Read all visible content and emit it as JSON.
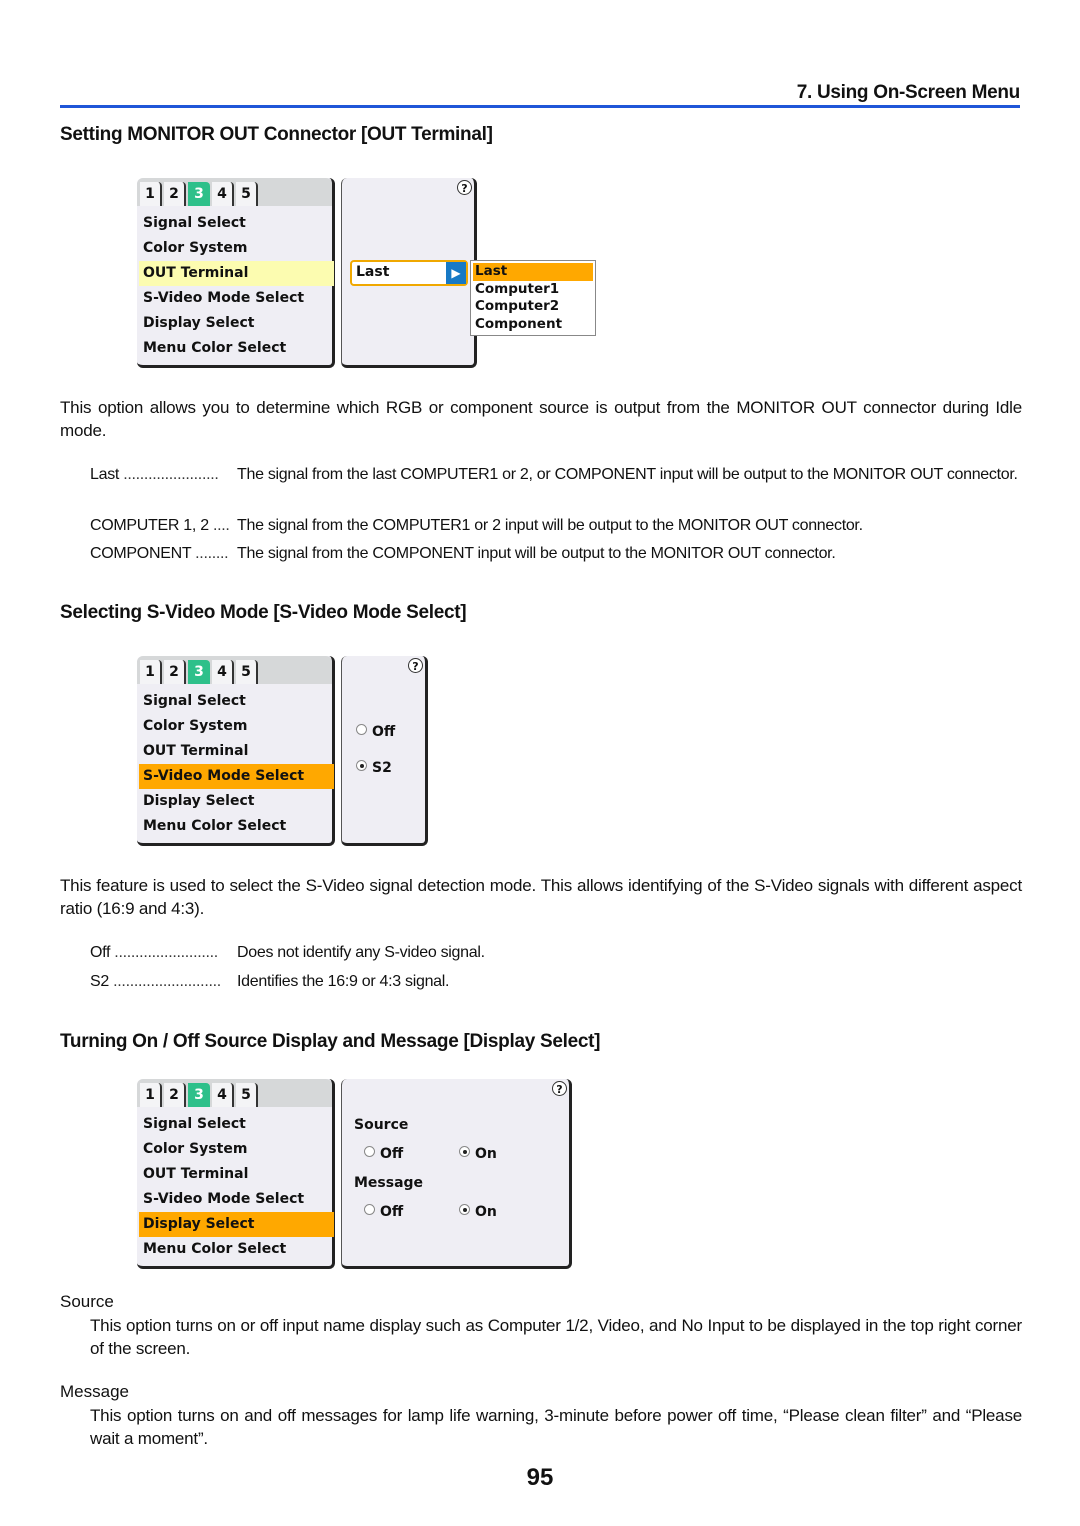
{
  "header": {
    "chapter_title": "7. Using On-Screen Menu",
    "accent_color": "#1f56d8"
  },
  "osd_common": {
    "tabs": [
      "1",
      "2",
      "3",
      "4",
      "5"
    ],
    "active_tab": "3",
    "menu_items": [
      "Signal Select",
      "Color System",
      "OUT Terminal",
      "S-Video Mode Select",
      "Display Select",
      "Menu Color Select"
    ],
    "help_icon": "?"
  },
  "sections": [
    {
      "heading": "Setting MONITOR OUT Connector [OUT Terminal]",
      "osd": {
        "highlighted_item": "OUT Terminal",
        "select_value": "Last",
        "dropdown_options": [
          "Last",
          "Computer1",
          "Computer2",
          "Component"
        ],
        "dropdown_selected": "Last"
      },
      "paragraph": "This option allows you to determine which RGB or component source is output from the MONITOR OUT connector during Idle mode.",
      "definitions": [
        {
          "term": "Last",
          "dots": " .......................",
          "desc": "The signal from the last COMPUTER1 or 2, or COMPONENT input will be output to the MONITOR OUT connector."
        },
        {
          "term": "COMPUTER 1, 2",
          "dots": " ....",
          "desc": "The signal from the COMPUTER1 or 2 input will be output to the MONITOR OUT connector."
        },
        {
          "term": "COMPONENT",
          "dots": " ........",
          "desc": "The signal from the COMPONENT input will be output to the MONITOR OUT connector."
        }
      ]
    },
    {
      "heading": "Selecting S-Video Mode [S-Video Mode Select]",
      "osd": {
        "highlighted_item": "S-Video Mode Select",
        "options": [
          {
            "label": "Off",
            "checked": false
          },
          {
            "label": "S2",
            "checked": true
          }
        ]
      },
      "paragraph": "This feature is used to select the S-Video signal detection mode. This allows identifying of the S-Video signals with different aspect ratio (16:9 and 4:3).",
      "definitions": [
        {
          "term": "Off",
          "dots": " .........................",
          "desc": "Does not identify any S-video signal."
        },
        {
          "term": "S2",
          "dots": " ..........................",
          "desc": "Identifies the 16:9 or 4:3 signal."
        }
      ]
    },
    {
      "heading": "Turning On / Off Source Display and Message [Display Select]",
      "osd": {
        "highlighted_item": "Display Select",
        "groups": [
          {
            "label": "Source",
            "off_label": "Off",
            "on_label": "On",
            "value": "On"
          },
          {
            "label": "Message",
            "off_label": "Off",
            "on_label": "On",
            "value": "On"
          }
        ]
      },
      "subsections": [
        {
          "label": "Source",
          "text": "This option turns on or off input name display such as Computer 1/2, Video, and No Input to be displayed in the top right corner of the screen."
        },
        {
          "label": "Message",
          "text": "This option turns on and off messages for lamp life warning, 3-minute before power off time, “Please clean filter” and “Please wait a moment”."
        }
      ]
    }
  ],
  "footer": {
    "page_number": "95"
  }
}
